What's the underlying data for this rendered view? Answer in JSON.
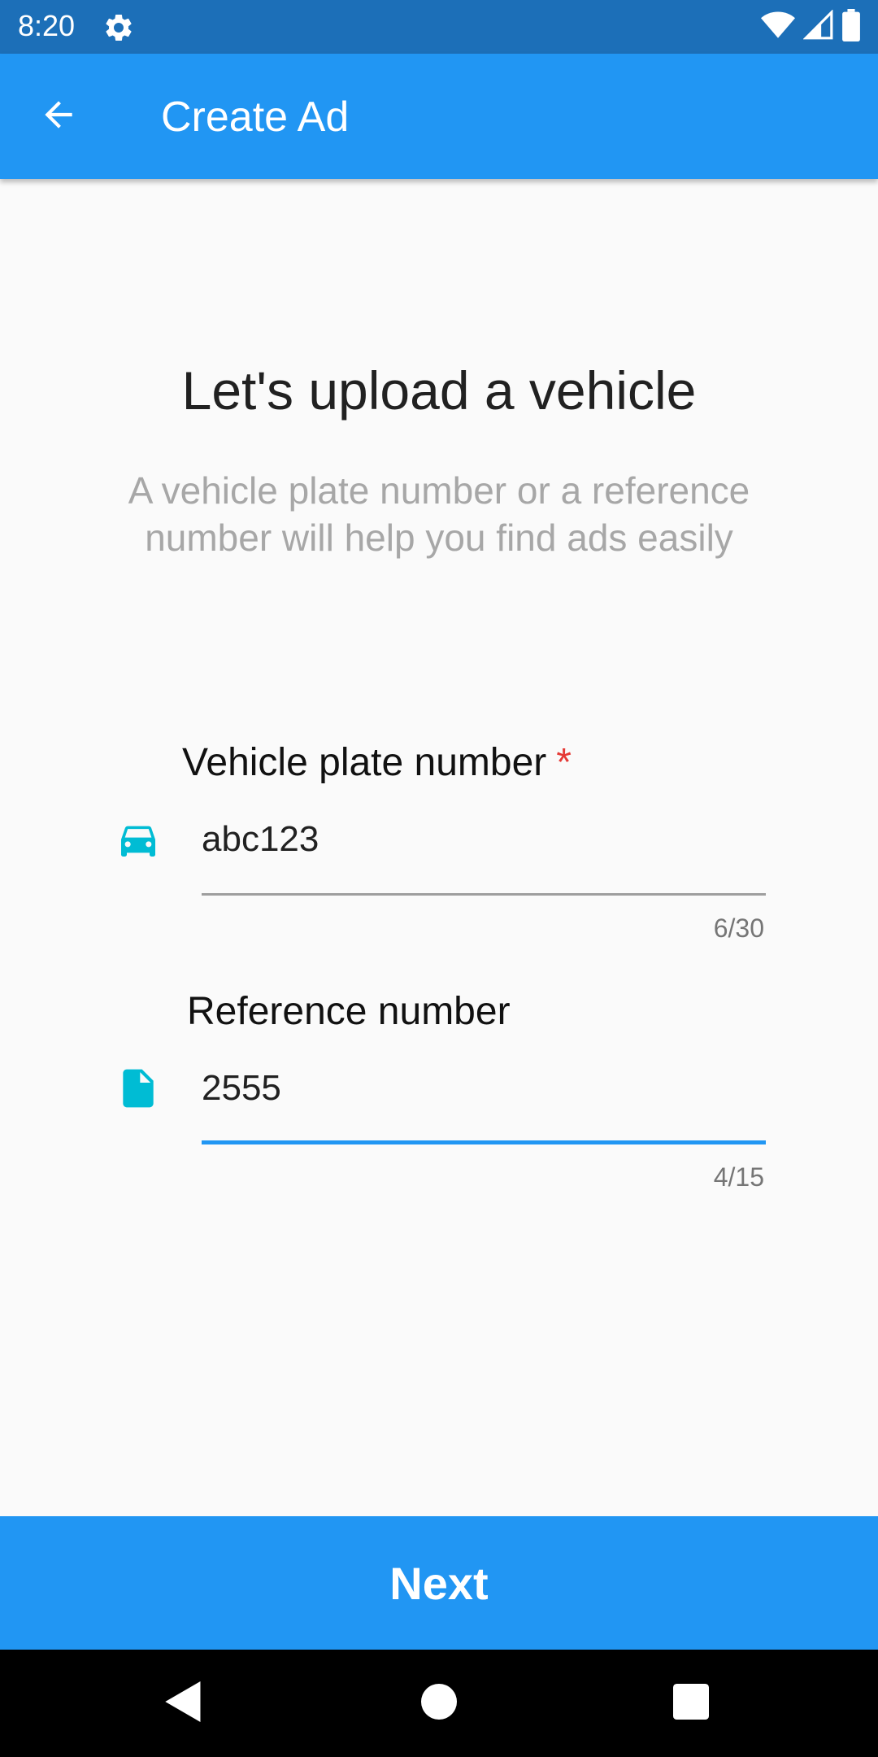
{
  "status_bar": {
    "time": "8:20"
  },
  "app_bar": {
    "title": "Create Ad"
  },
  "intro": {
    "heading": "Let's upload a vehicle",
    "subheading": "A vehicle plate number or a reference number will help you find ads easily"
  },
  "fields": {
    "plate": {
      "label": "Vehicle plate number",
      "required_mark": "*",
      "value": "abc123",
      "counter": "6/30"
    },
    "reference": {
      "label": "Reference number",
      "value": "2555",
      "counter": "4/15"
    }
  },
  "actions": {
    "next_label": "Next"
  },
  "colors": {
    "primary": "#2196f3",
    "status_bar": "#1c6fb8",
    "icon_accent": "#00bcd4",
    "required": "#e53935"
  },
  "icons": {
    "status": [
      "gear-icon",
      "wifi-icon",
      "signal-icon",
      "battery-icon"
    ],
    "app_bar": "back-arrow-icon",
    "plate_field": "car-icon",
    "reference_field": "document-icon",
    "nav": [
      "back-triangle-icon",
      "home-circle-icon",
      "recents-square-icon"
    ]
  }
}
